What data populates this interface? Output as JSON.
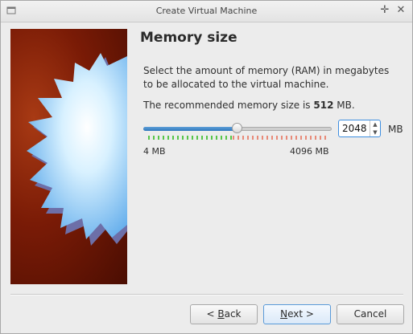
{
  "window": {
    "title": "Create Virtual Machine"
  },
  "page": {
    "heading": "Memory size",
    "description": "Select the amount of memory (RAM) in megabytes to be allocated to the virtual machine.",
    "recommended_prefix": "The recommended memory size is",
    "recommended_value": "512",
    "recommended_suffix": "MB."
  },
  "memory": {
    "value": "2048",
    "unit": "MB",
    "min_label": "4 MB",
    "max_label": "4096 MB",
    "min": 4,
    "max": 4096,
    "current": 2048,
    "safe_fraction": 0.47
  },
  "buttons": {
    "back_prefix": "< ",
    "back_accel": "B",
    "back_rest": "ack",
    "next_accel": "N",
    "next_rest": "ext >",
    "cancel": "Cancel"
  },
  "colors": {
    "accent": "#2f78bd",
    "safe_scale": "#57c54a",
    "unsafe_scale": "#e88a78"
  },
  "icons": [
    "window-menu-icon",
    "maximize-icon",
    "close-icon",
    "starburst-illustration",
    "spin-up-icon",
    "spin-down-icon"
  ]
}
